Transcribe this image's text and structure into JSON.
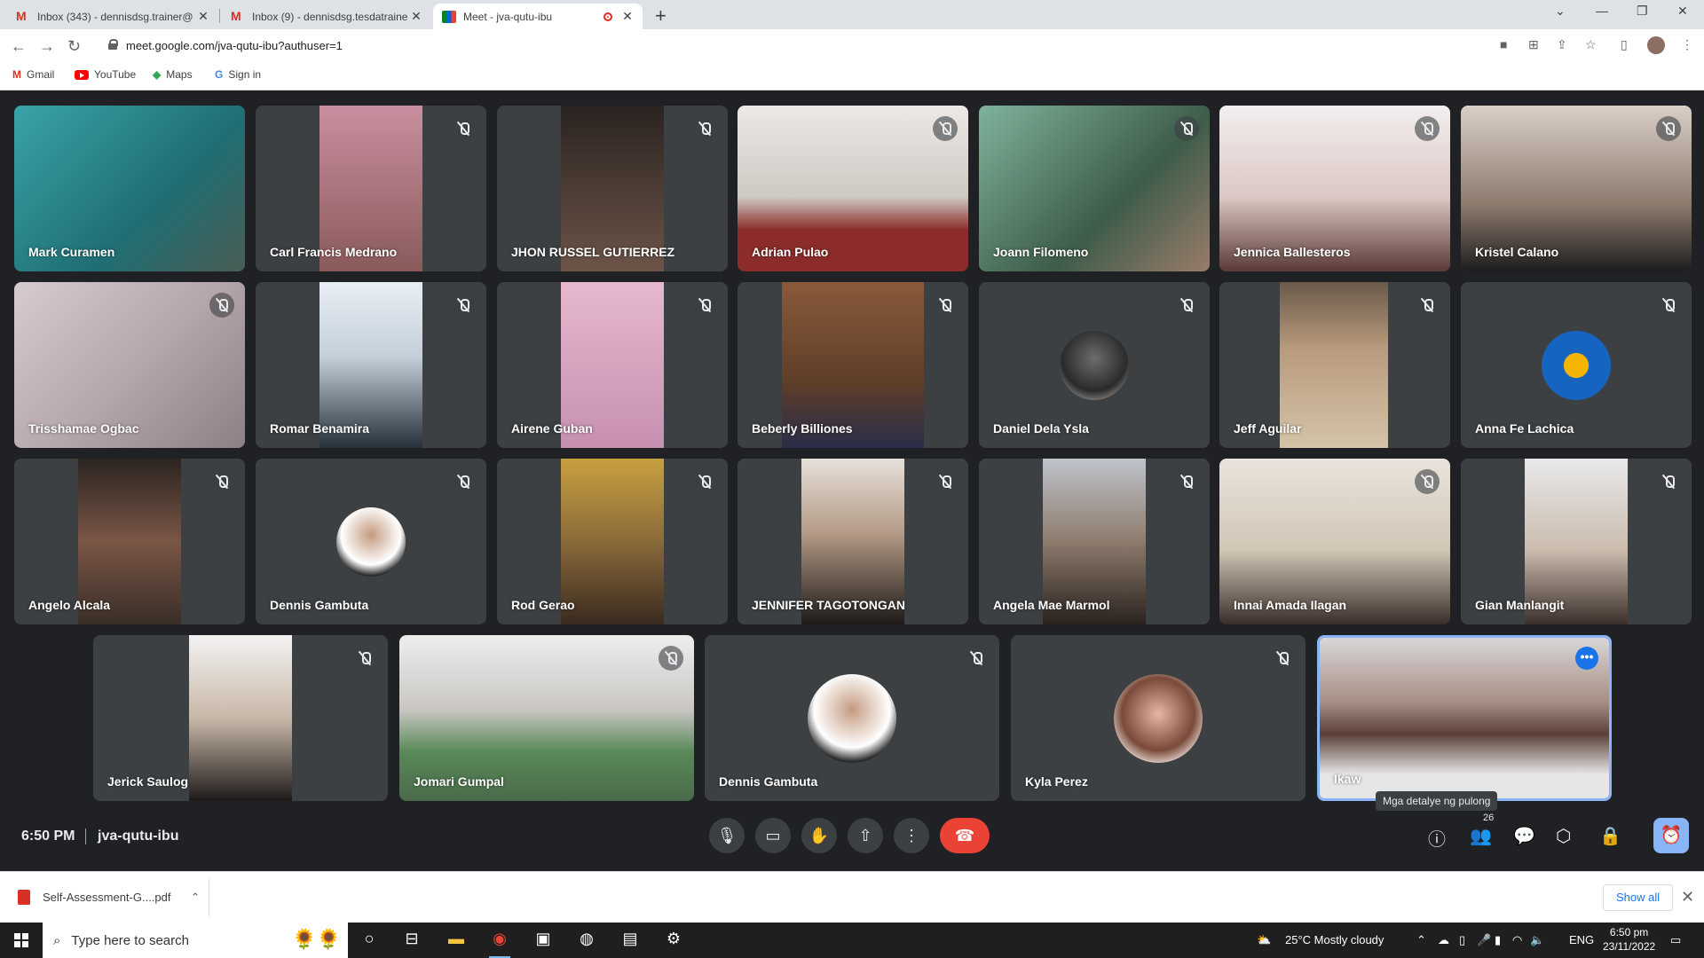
{
  "browser": {
    "tabs": [
      {
        "title": "Inbox (343) - dennisdsg.trainer@"
      },
      {
        "title": "Inbox (9) - dennisdsg.tesdatraine"
      },
      {
        "title": "Meet - jva-qutu-ibu"
      }
    ],
    "url": "meet.google.com/jva-qutu-ibu?authuser=1",
    "bookmarks": [
      "Gmail",
      "YouTube",
      "Maps",
      "Sign in"
    ]
  },
  "meeting": {
    "time": "6:50 PM",
    "code": "jva-qutu-ibu",
    "participant_count": "26",
    "tooltip": "Mga detalye ng pulong",
    "participants": [
      "Mark Curamen",
      "Carl Francis Medrano",
      "JHON RUSSEL GUTIERREZ",
      "Adrian Pulao",
      "Joann Filomeno",
      "Jennica Ballesteros",
      "Kristel Calano",
      "Trisshamae Ogbac",
      "Romar Benamira",
      "Airene Guban",
      "Beberly Billiones",
      "Daniel Dela Ysla",
      "Jeff Aguilar",
      "Anna Fe Lachica",
      "Angelo Alcala",
      "Dennis Gambuta",
      "Rod Gerao",
      "JENNIFER TAGOTONGAN",
      "Angela Mae Marmol",
      "Innai Amada Ilagan",
      "Gian Manlangit",
      "Jerick Saulog",
      "Jomari Gumpal",
      "Dennis Gambuta",
      "Kyla Perez",
      "Ikaw"
    ]
  },
  "downloads": {
    "file": "Self-Assessment-G....pdf",
    "show_all": "Show all"
  },
  "taskbar": {
    "search_placeholder": "Type here to search",
    "weather": "25°C  Mostly cloudy",
    "lang": "ENG",
    "time": "6:50 pm",
    "date": "23/11/2022"
  }
}
